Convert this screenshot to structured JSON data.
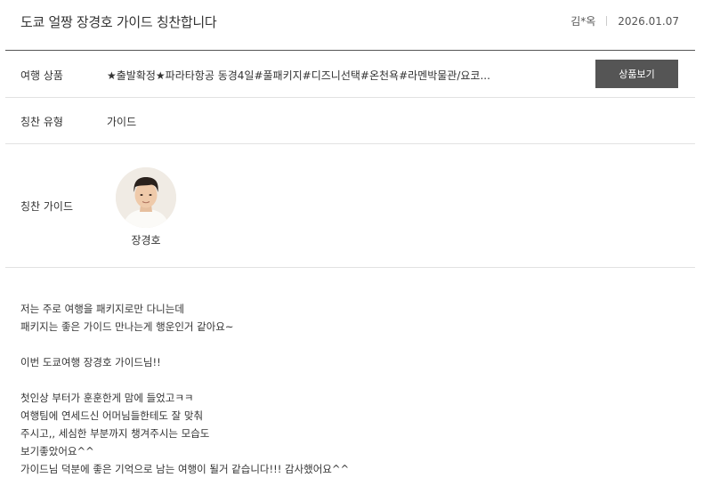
{
  "review": {
    "title": "도쿄 얼짱 장경호 가이드 칭찬합니다",
    "author": "김*옥",
    "date": "2026.01.07"
  },
  "product": {
    "label": "여행 상품",
    "value": "★출발확정★파라타항공 동경4일#풀패키지#디즈니선택#온천욕#라멘박물관/요코...",
    "button_label": "상품보기"
  },
  "praise_type": {
    "label": "칭찬 유형",
    "value": "가이드"
  },
  "guide": {
    "label": "칭찬 가이드",
    "name": "장경호",
    "avatar_icon": "guide-portrait-icon"
  },
  "content": {
    "lines": [
      "저는 주로 여행을 패키지로만 다니는데",
      "패키지는 좋은 가이드 만나는게 행운인거 같아요~",
      "",
      "이번 도쿄여행 장경호 가이드님!!",
      "",
      "첫인상 부터가 훈훈한게 맘에 들었고ㅋㅋ",
      "여행팀에 연세드신 어머님들한테도 잘 맞춰",
      "주시고,, 세심한 부분까지 챙겨주시는 모습도",
      "보기좋았어요^^",
      "가이드님 덕분에 좋은 기억으로 남는 여행이 될거 같습니다!!! 감사했어요^^"
    ]
  },
  "colors": {
    "button_bg": "#555555",
    "header_rule": "#555555",
    "row_rule": "#e2e2e2"
  }
}
